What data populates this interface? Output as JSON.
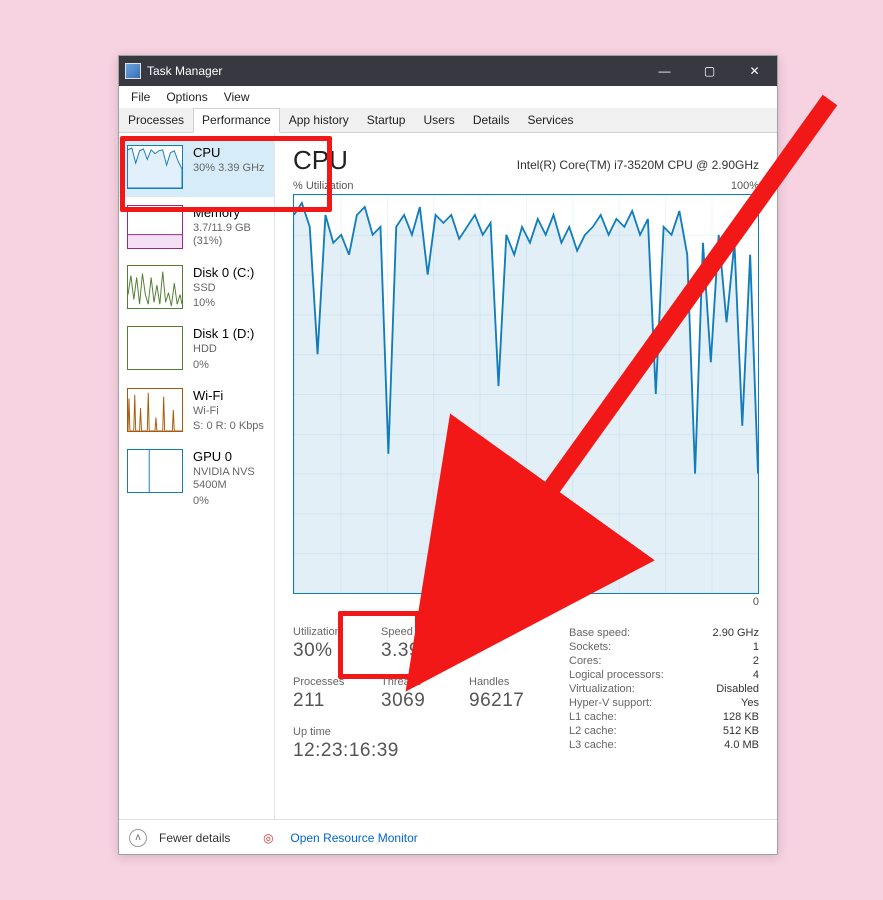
{
  "window": {
    "title": "Task Manager"
  },
  "menu": {
    "file": "File",
    "options": "Options",
    "view": "View"
  },
  "tabs": {
    "processes": "Processes",
    "performance": "Performance",
    "apphistory": "App history",
    "startup": "Startup",
    "users": "Users",
    "details": "Details",
    "services": "Services"
  },
  "side": {
    "cpu": {
      "label": "CPU",
      "sub": "30%  3.39 GHz"
    },
    "mem": {
      "label": "Memory",
      "sub": "3.7/11.9 GB (31%)"
    },
    "disk0": {
      "label": "Disk 0 (C:)",
      "sub1": "SSD",
      "sub2": "10%"
    },
    "disk1": {
      "label": "Disk 1 (D:)",
      "sub1": "HDD",
      "sub2": "0%"
    },
    "wifi": {
      "label": "Wi-Fi",
      "sub1": "Wi-Fi",
      "sub2": "S: 0 R: 0 Kbps"
    },
    "gpu": {
      "label": "GPU 0",
      "sub1": "NVIDIA NVS 5400M",
      "sub2": "0%"
    }
  },
  "main": {
    "title": "CPU",
    "model": "Intel(R) Core(TM) i7-3520M CPU @ 2.90GHz",
    "chart_top_left": "% Utilization",
    "chart_top_right": "100%",
    "chart_bot_right": "0"
  },
  "stats": {
    "utilization": {
      "label": "Utilization",
      "value": "30%"
    },
    "speed": {
      "label": "Speed",
      "value": "3.39 GHz"
    },
    "processes": {
      "label": "Processes",
      "value": "211"
    },
    "threads": {
      "label": "Threads",
      "value": "3069"
    },
    "handles": {
      "label": "Handles",
      "value": "96217"
    },
    "uptime": {
      "label": "Up time",
      "value": "12:23:16:39"
    }
  },
  "info": {
    "base_speed": {
      "k": "Base speed:",
      "v": "2.90 GHz"
    },
    "sockets": {
      "k": "Sockets:",
      "v": "1"
    },
    "cores": {
      "k": "Cores:",
      "v": "2"
    },
    "logical": {
      "k": "Logical processors:",
      "v": "4"
    },
    "virt": {
      "k": "Virtualization:",
      "v": "Disabled"
    },
    "hyperv": {
      "k": "Hyper-V support:",
      "v": "Yes"
    },
    "l1": {
      "k": "L1 cache:",
      "v": "128 KB"
    },
    "l2": {
      "k": "L2 cache:",
      "v": "512 KB"
    },
    "l3": {
      "k": "L3 cache:",
      "v": "4.0 MB"
    }
  },
  "footer": {
    "fewer": "Fewer details",
    "orm": "Open Resource Monitor"
  },
  "chart_data": {
    "type": "line",
    "title": "CPU % Utilization",
    "ylabel": "% Utilization",
    "ylim": [
      0,
      100
    ],
    "x": [
      0,
      1,
      2,
      3,
      4,
      5,
      6,
      7,
      8,
      9,
      10,
      11,
      12,
      13,
      14,
      15,
      16,
      17,
      18,
      19,
      20,
      21,
      22,
      23,
      24,
      25,
      26,
      27,
      28,
      29,
      30,
      31,
      32,
      33,
      34,
      35,
      36,
      37,
      38,
      39,
      40,
      41,
      42,
      43,
      44,
      45,
      46,
      47,
      48,
      49,
      50,
      51,
      52,
      53,
      54,
      55,
      56,
      57,
      58,
      59
    ],
    "values": [
      95,
      98,
      92,
      60,
      95,
      88,
      90,
      85,
      95,
      97,
      90,
      92,
      35,
      92,
      95,
      90,
      97,
      80,
      95,
      93,
      95,
      89,
      92,
      95,
      90,
      93,
      52,
      90,
      85,
      92,
      88,
      94,
      90,
      95,
      88,
      92,
      86,
      90,
      92,
      95,
      90,
      94,
      92,
      96,
      90,
      94,
      50,
      92,
      90,
      96,
      85,
      30,
      88,
      58,
      90,
      68,
      88,
      42,
      85,
      30
    ]
  }
}
